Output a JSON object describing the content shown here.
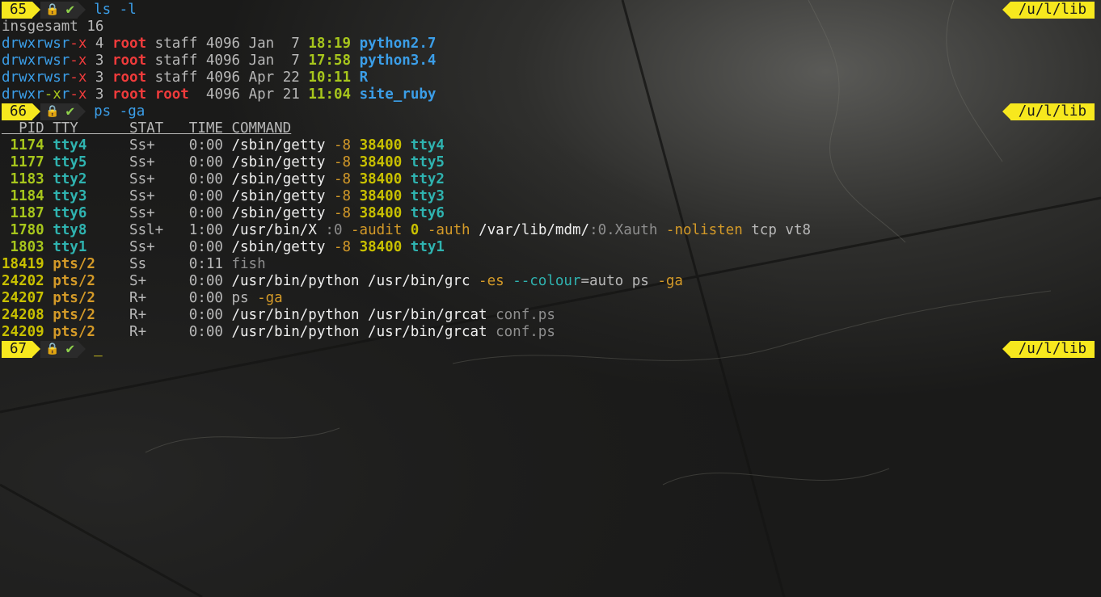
{
  "colors": {
    "prompt_bg": "#f7e81e",
    "lock": "#e5553b",
    "check": "#8fd14b",
    "blue": "#3b9ee8",
    "red": "#ef3b3b",
    "green": "#a7c61c",
    "cyan": "#2fb3b0",
    "orange": "#d49a28",
    "white": "#eeeeee",
    "grey": "#b8b8b8",
    "dim": "#8e8e8e",
    "yellow": "#c8c000"
  },
  "icons": {
    "lock": "lock-icon",
    "check": "check-icon"
  },
  "lines": [
    {
      "type": "prompt",
      "number": "65",
      "lock": "🔒",
      "check": "✔",
      "cmd": [
        {
          "t": "ls",
          "c": "blue"
        },
        {
          "t": " -l",
          "c": "blue"
        }
      ],
      "path": "/u/l/lib"
    },
    {
      "type": "text",
      "segs": [
        {
          "t": "insgesamt 16",
          "c": "grey"
        }
      ]
    },
    {
      "type": "text",
      "segs": [
        {
          "t": "drwxrwsr",
          "c": "blue"
        },
        {
          "t": "-x",
          "c": "red"
        },
        {
          "t": " 4 ",
          "c": "grey"
        },
        {
          "t": "root",
          "c": "red",
          "b": true
        },
        {
          "t": " staff 4096 Jan  7 ",
          "c": "grey"
        },
        {
          "t": "18:19",
          "c": "green",
          "b": true
        },
        {
          "t": " ",
          "c": "grey"
        },
        {
          "t": "python2.7",
          "c": "blue",
          "b": true
        }
      ]
    },
    {
      "type": "text",
      "segs": [
        {
          "t": "drwxrwsr",
          "c": "blue"
        },
        {
          "t": "-x",
          "c": "red"
        },
        {
          "t": " 3 ",
          "c": "grey"
        },
        {
          "t": "root",
          "c": "red",
          "b": true
        },
        {
          "t": " staff 4096 Jan  7 ",
          "c": "grey"
        },
        {
          "t": "17:58",
          "c": "green",
          "b": true
        },
        {
          "t": " ",
          "c": "grey"
        },
        {
          "t": "python3.4",
          "c": "blue",
          "b": true
        }
      ]
    },
    {
      "type": "text",
      "segs": [
        {
          "t": "drwxrwsr",
          "c": "blue"
        },
        {
          "t": "-x",
          "c": "red"
        },
        {
          "t": " 3 ",
          "c": "grey"
        },
        {
          "t": "root",
          "c": "red",
          "b": true
        },
        {
          "t": " staff 4096 Apr 22 ",
          "c": "grey"
        },
        {
          "t": "10:11",
          "c": "green",
          "b": true
        },
        {
          "t": " ",
          "c": "grey"
        },
        {
          "t": "R",
          "c": "blue",
          "b": true
        }
      ]
    },
    {
      "type": "text",
      "segs": [
        {
          "t": "drwxr",
          "c": "blue"
        },
        {
          "t": "-x",
          "c": "green"
        },
        {
          "t": "r",
          "c": "blue"
        },
        {
          "t": "-x",
          "c": "red"
        },
        {
          "t": " 3 ",
          "c": "grey"
        },
        {
          "t": "root",
          "c": "red",
          "b": true
        },
        {
          "t": " ",
          "c": "grey"
        },
        {
          "t": "root",
          "c": "red",
          "b": true
        },
        {
          "t": "  4096 Apr 21 ",
          "c": "grey"
        },
        {
          "t": "11:04",
          "c": "green",
          "b": true
        },
        {
          "t": " ",
          "c": "grey"
        },
        {
          "t": "site_ruby",
          "c": "blue",
          "b": true
        }
      ]
    },
    {
      "type": "prompt",
      "number": "66",
      "lock": "🔒",
      "check": "✔",
      "cmd": [
        {
          "t": "ps",
          "c": "blue"
        },
        {
          "t": " -ga",
          "c": "blue"
        }
      ],
      "path": "/u/l/lib"
    },
    {
      "type": "text",
      "hdr": true,
      "segs": [
        {
          "t": "  PID TTY      STAT   TIME COMMAND",
          "c": "grey"
        }
      ]
    },
    {
      "type": "text",
      "segs": [
        {
          "t": " 1174 ",
          "c": "green",
          "b": true
        },
        {
          "t": "tty4",
          "c": "cyan",
          "b": true
        },
        {
          "t": "     Ss+    0:00 ",
          "c": "grey"
        },
        {
          "t": "/sbin/getty ",
          "c": "white"
        },
        {
          "t": "-8",
          "c": "orange"
        },
        {
          "t": " ",
          "c": "grey"
        },
        {
          "t": "38400",
          "c": "yellow",
          "b": true
        },
        {
          "t": " ",
          "c": "grey"
        },
        {
          "t": "tty4",
          "c": "cyan",
          "b": true
        }
      ]
    },
    {
      "type": "text",
      "segs": [
        {
          "t": " 1177 ",
          "c": "green",
          "b": true
        },
        {
          "t": "tty5",
          "c": "cyan",
          "b": true
        },
        {
          "t": "     Ss+    0:00 ",
          "c": "grey"
        },
        {
          "t": "/sbin/getty ",
          "c": "white"
        },
        {
          "t": "-8",
          "c": "orange"
        },
        {
          "t": " ",
          "c": "grey"
        },
        {
          "t": "38400",
          "c": "yellow",
          "b": true
        },
        {
          "t": " ",
          "c": "grey"
        },
        {
          "t": "tty5",
          "c": "cyan",
          "b": true
        }
      ]
    },
    {
      "type": "text",
      "segs": [
        {
          "t": " 1183 ",
          "c": "green",
          "b": true
        },
        {
          "t": "tty2",
          "c": "cyan",
          "b": true
        },
        {
          "t": "     Ss+    0:00 ",
          "c": "grey"
        },
        {
          "t": "/sbin/getty ",
          "c": "white"
        },
        {
          "t": "-8",
          "c": "orange"
        },
        {
          "t": " ",
          "c": "grey"
        },
        {
          "t": "38400",
          "c": "yellow",
          "b": true
        },
        {
          "t": " ",
          "c": "grey"
        },
        {
          "t": "tty2",
          "c": "cyan",
          "b": true
        }
      ]
    },
    {
      "type": "text",
      "segs": [
        {
          "t": " 1184 ",
          "c": "green",
          "b": true
        },
        {
          "t": "tty3",
          "c": "cyan",
          "b": true
        },
        {
          "t": "     Ss+    0:00 ",
          "c": "grey"
        },
        {
          "t": "/sbin/getty ",
          "c": "white"
        },
        {
          "t": "-8",
          "c": "orange"
        },
        {
          "t": " ",
          "c": "grey"
        },
        {
          "t": "38400",
          "c": "yellow",
          "b": true
        },
        {
          "t": " ",
          "c": "grey"
        },
        {
          "t": "tty3",
          "c": "cyan",
          "b": true
        }
      ]
    },
    {
      "type": "text",
      "segs": [
        {
          "t": " 1187 ",
          "c": "green",
          "b": true
        },
        {
          "t": "tty6",
          "c": "cyan",
          "b": true
        },
        {
          "t": "     Ss+    0:00 ",
          "c": "grey"
        },
        {
          "t": "/sbin/getty ",
          "c": "white"
        },
        {
          "t": "-8",
          "c": "orange"
        },
        {
          "t": " ",
          "c": "grey"
        },
        {
          "t": "38400",
          "c": "yellow",
          "b": true
        },
        {
          "t": " ",
          "c": "grey"
        },
        {
          "t": "tty6",
          "c": "cyan",
          "b": true
        }
      ]
    },
    {
      "type": "text",
      "segs": [
        {
          "t": " 1780 ",
          "c": "green",
          "b": true
        },
        {
          "t": "tty8",
          "c": "cyan",
          "b": true
        },
        {
          "t": "     Ssl+   1:00 ",
          "c": "grey"
        },
        {
          "t": "/usr/bin/X ",
          "c": "white"
        },
        {
          "t": ":0 ",
          "c": "dim"
        },
        {
          "t": "-audit",
          "c": "orange"
        },
        {
          "t": " ",
          "c": "grey"
        },
        {
          "t": "0",
          "c": "yellow",
          "b": true
        },
        {
          "t": " ",
          "c": "grey"
        },
        {
          "t": "-auth",
          "c": "orange"
        },
        {
          "t": " /var/lib/mdm/",
          "c": "white"
        },
        {
          "t": ":0.Xauth ",
          "c": "dim"
        },
        {
          "t": "-nolisten",
          "c": "orange"
        },
        {
          "t": " tcp vt8",
          "c": "grey"
        }
      ]
    },
    {
      "type": "text",
      "segs": [
        {
          "t": " 1803 ",
          "c": "green",
          "b": true
        },
        {
          "t": "tty1",
          "c": "cyan",
          "b": true
        },
        {
          "t": "     Ss+    0:00 ",
          "c": "grey"
        },
        {
          "t": "/sbin/getty ",
          "c": "white"
        },
        {
          "t": "-8",
          "c": "orange"
        },
        {
          "t": " ",
          "c": "grey"
        },
        {
          "t": "38400",
          "c": "yellow",
          "b": true
        },
        {
          "t": " ",
          "c": "grey"
        },
        {
          "t": "tty1",
          "c": "cyan",
          "b": true
        }
      ]
    },
    {
      "type": "text",
      "segs": [
        {
          "t": "18419 ",
          "c": "yellow",
          "b": true
        },
        {
          "t": "pts/2",
          "c": "orange",
          "b": true
        },
        {
          "t": "    Ss     0:11 ",
          "c": "grey"
        },
        {
          "t": "fish",
          "c": "dim"
        }
      ]
    },
    {
      "type": "text",
      "segs": [
        {
          "t": "24202 ",
          "c": "yellow",
          "b": true
        },
        {
          "t": "pts/2",
          "c": "orange",
          "b": true
        },
        {
          "t": "    S+     0:00 ",
          "c": "grey"
        },
        {
          "t": "/usr/bin/python /usr/bin/grc ",
          "c": "white"
        },
        {
          "t": "-es",
          "c": "orange"
        },
        {
          "t": " ",
          "c": "grey"
        },
        {
          "t": "--colour",
          "c": "cyan"
        },
        {
          "t": "=auto ps ",
          "c": "grey"
        },
        {
          "t": "-ga",
          "c": "orange"
        }
      ]
    },
    {
      "type": "text",
      "segs": [
        {
          "t": "24207 ",
          "c": "yellow",
          "b": true
        },
        {
          "t": "pts/2",
          "c": "orange",
          "b": true
        },
        {
          "t": "    R+     0:00 ",
          "c": "grey"
        },
        {
          "t": "ps ",
          "c": "grey"
        },
        {
          "t": "-ga",
          "c": "orange"
        }
      ]
    },
    {
      "type": "text",
      "segs": [
        {
          "t": "24208 ",
          "c": "yellow",
          "b": true
        },
        {
          "t": "pts/2",
          "c": "orange",
          "b": true
        },
        {
          "t": "    R+     0:00 ",
          "c": "grey"
        },
        {
          "t": "/usr/bin/python /usr/bin/grcat ",
          "c": "white"
        },
        {
          "t": "conf.ps",
          "c": "dim"
        }
      ]
    },
    {
      "type": "text",
      "segs": [
        {
          "t": "24209 ",
          "c": "yellow",
          "b": true
        },
        {
          "t": "pts/2",
          "c": "orange",
          "b": true
        },
        {
          "t": "    R+     0:00 ",
          "c": "grey"
        },
        {
          "t": "/usr/bin/python /usr/bin/grcat ",
          "c": "white"
        },
        {
          "t": "conf.ps",
          "c": "dim"
        }
      ]
    },
    {
      "type": "prompt",
      "number": "67",
      "lock": "🔒",
      "check": "✔",
      "cmd": [],
      "cursor": "_",
      "path": "/u/l/lib"
    }
  ]
}
